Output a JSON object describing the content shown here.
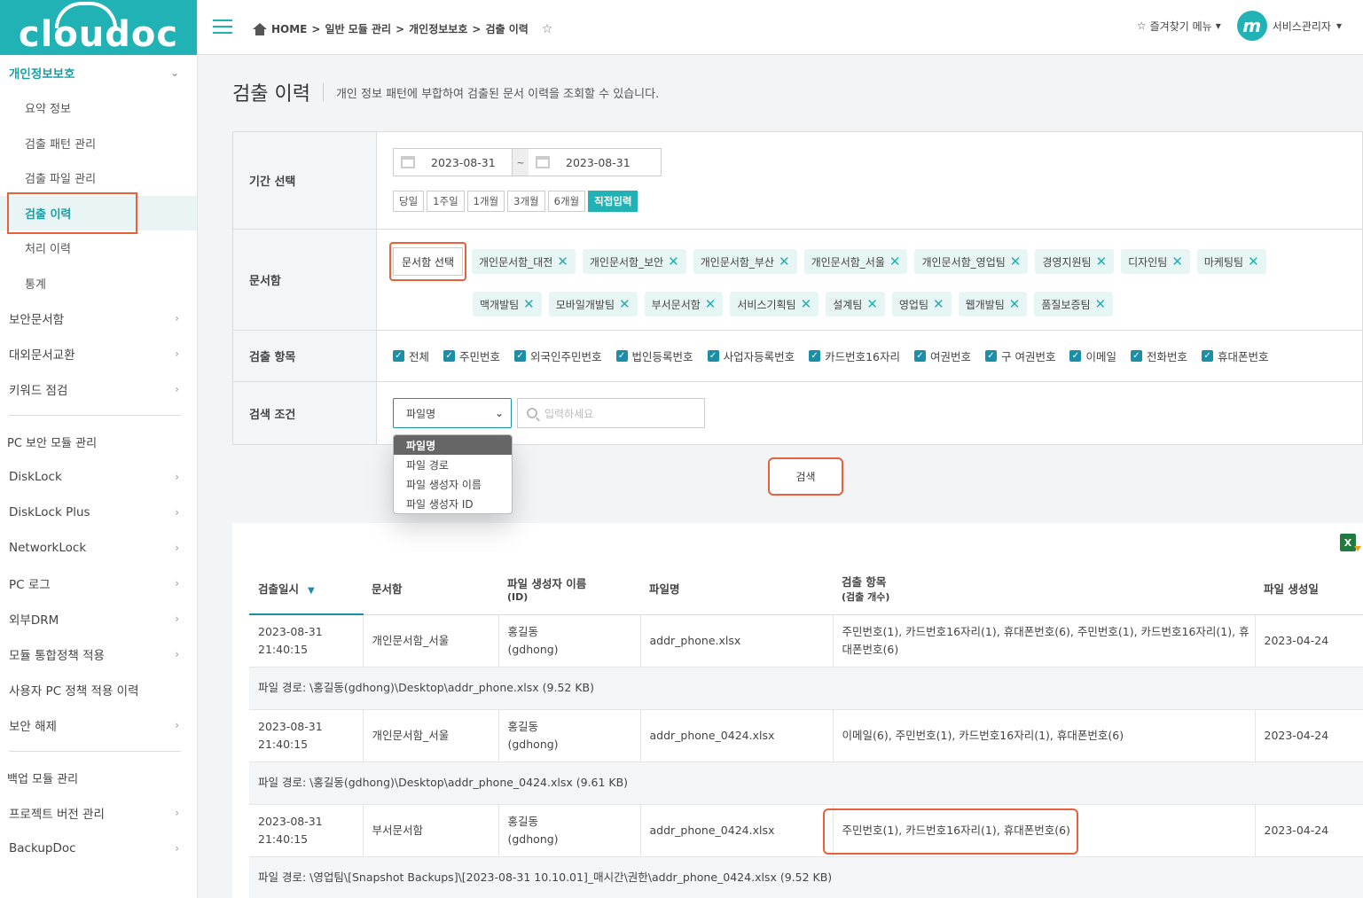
{
  "logo": "cloudoc",
  "sidebar": {
    "section_open": "개인정보보호",
    "sub_items": [
      "요약 정보",
      "검출 패턴 관리",
      "검출 파일 관리",
      "검출 이력",
      "처리 이력",
      "통계"
    ],
    "group1": [
      "보안문서함",
      "대외문서교환",
      "키워드 점검"
    ],
    "group2_title": "PC 보안 모듈 관리",
    "group2": [
      "DiskLock",
      "DiskLock Plus",
      "NetworkLock",
      "PC 로그",
      "외부DRM",
      "모듈 통합정책 적용",
      "사용자 PC 정책 적용 이력",
      "보안 해제"
    ],
    "group3_title": "백업 모듈 관리",
    "group3": [
      "프로젝트 버전 관리",
      "BackupDoc"
    ]
  },
  "topbar": {
    "breadcrumb": [
      "HOME",
      ">",
      "일반 모듈 관리",
      ">",
      "개인정보보호",
      ">",
      "검출 이력"
    ],
    "favorites": "즐겨찾기 메뉴",
    "avatar_letter": "m",
    "user": "서비스관리자"
  },
  "page": {
    "title": "검출 이력",
    "description": "개인 정보 패턴에 부합하여 검출된 문서 이력을 조회할 수 있습니다."
  },
  "form": {
    "period_label": "기간 선택",
    "date_from": "2023-08-31",
    "date_sep": "~",
    "date_to": "2023-08-31",
    "period_buttons": [
      "당일",
      "1주일",
      "1개월",
      "3개월",
      "6개월",
      "직접입력"
    ],
    "docbox_label": "문서함",
    "docbox_button": "문서함 선택",
    "tags_line1": [
      "개인문서함_대전",
      "개인문서함_보안",
      "개인문서함_부산",
      "개인문서함_서울",
      "개인문서함_영업팀",
      "경영지원팀",
      "디자인팀",
      "마케팅팀"
    ],
    "tags_line2": [
      "맥개발팀",
      "모바일개발팀",
      "부서문서함",
      "서비스기획팀",
      "설계팀",
      "영업팀",
      "웹개발팀",
      "품질보증팀"
    ],
    "items_label": "검출 항목",
    "items": [
      "전체",
      "주민번호",
      "외국인주민번호",
      "법인등록번호",
      "사업자등록번호",
      "카드번호16자리",
      "여권번호",
      "구 여권번호",
      "이메일",
      "전화번호",
      "휴대폰번호"
    ],
    "cond_label": "검색 조건",
    "select_value": "파일명",
    "search_placeholder": "입력하세요",
    "dropdown_options": [
      "파일명",
      "파일 경로",
      "파일 생성자 이름",
      "파일 생성자 ID"
    ],
    "search_button": "검색"
  },
  "results": {
    "excel_label": "X",
    "headers": {
      "date": "검출일시",
      "docbox": "문서함",
      "creator": "파일 생성자 이름",
      "creator_sub": "(ID)",
      "filename": "파일명",
      "items": "검출 항목",
      "items_sub": "(검출 개수)",
      "created": "파일 생성일"
    },
    "rows": [
      {
        "date": "2023-08-31",
        "time": "21:40:15",
        "docbox": "개인문서함_서울",
        "creator": "홍길동",
        "creator_id": "(gdhong)",
        "filename": "addr_phone.xlsx",
        "items": "주민번호(1), 카드번호16자리(1), 휴대폰번호(6), 주민번호(1), 카드번호16자리(1), 휴대폰번호(6)",
        "created": "2023-04-24",
        "path": "파일 경로: \\홍길동(gdhong)\\Desktop\\addr_phone.xlsx (9.52 KB)"
      },
      {
        "date": "2023-08-31",
        "time": "21:40:15",
        "docbox": "개인문서함_서울",
        "creator": "홍길동",
        "creator_id": "(gdhong)",
        "filename": "addr_phone_0424.xlsx",
        "items": "이메일(6), 주민번호(1), 카드번호16자리(1), 휴대폰번호(6)",
        "created": "2023-04-24",
        "path": "파일 경로: \\홍길동(gdhong)\\Desktop\\addr_phone_0424.xlsx (9.61 KB)"
      },
      {
        "date": "2023-08-31",
        "time": "21:40:15",
        "docbox": "부서문서함",
        "creator": "홍길동",
        "creator_id": "(gdhong)",
        "filename": "addr_phone_0424.xlsx",
        "items": "주민번호(1), 카드번호16자리(1), 휴대폰번호(6)",
        "created": "2023-04-24",
        "path": "파일 경로: \\영업팀\\[Snapshot Backups]\\[2023-08-31 10.10.01]_매시간\\권한\\addr_phone_0424.xlsx (9.52 KB)"
      }
    ]
  },
  "colors": {
    "accent": "#20b2b4",
    "highlight": "#e8603c",
    "check": "#1c8fa8"
  }
}
